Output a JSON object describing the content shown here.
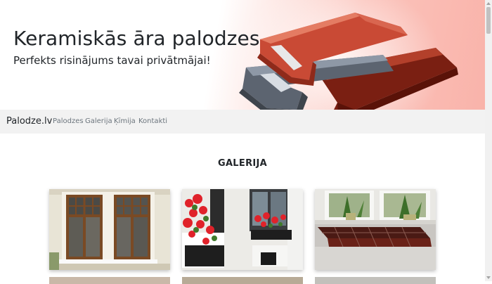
{
  "hero": {
    "title": "Keramiskās āra palodzes",
    "subtitle": "Perfekts risinājums tavai privātmājai!"
  },
  "navbar": {
    "brand": "Palodze.lv",
    "links": [
      "Palodzes",
      "Galerija",
      "Ķīmija",
      "Kontakti"
    ]
  },
  "gallery": {
    "heading": "GALERIJA",
    "images": [
      {
        "icon": "wooden-window-photo"
      },
      {
        "icon": "flower-box-window-photo"
      },
      {
        "icon": "tiled-windowsill-photo"
      }
    ]
  },
  "colors": {
    "accent": "#f9b3aa",
    "navbar_bg": "#f2f2f2",
    "text": "#212529",
    "muted": "#6c757d"
  }
}
